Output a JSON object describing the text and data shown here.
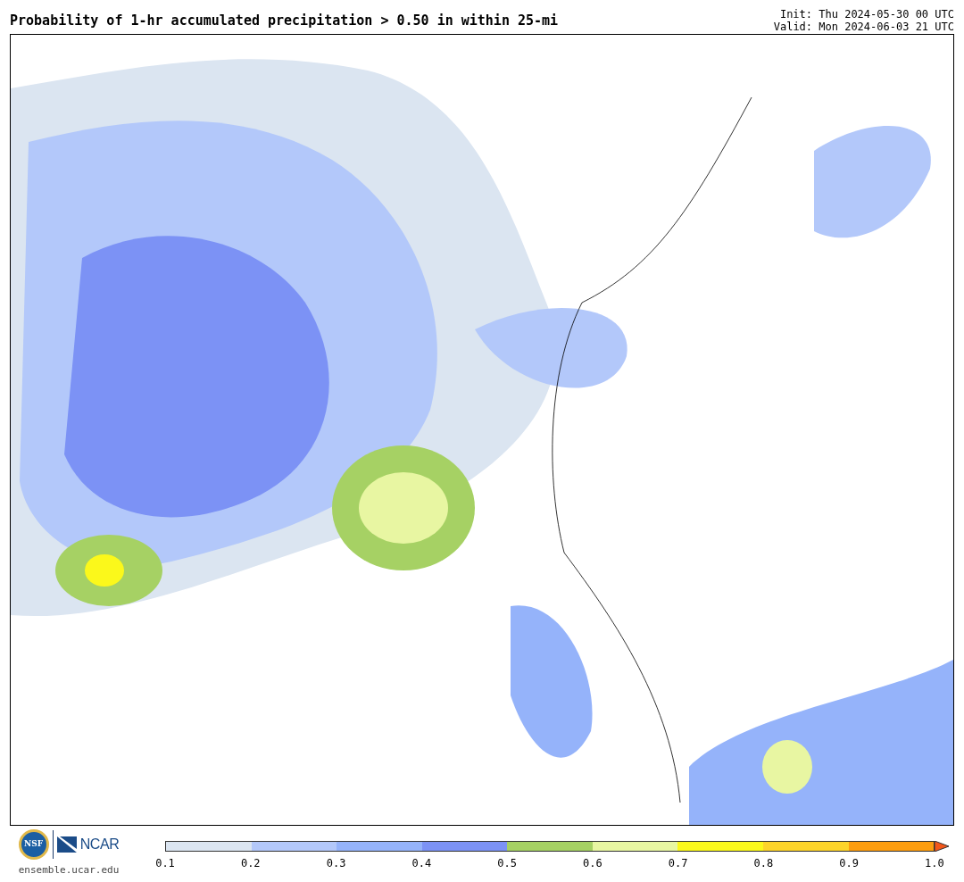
{
  "title": "Probability of 1-hr accumulated precipitation > 0.50 in within 25-mi",
  "init": "Init: Thu 2024-05-30 00 UTC",
  "valid": "Valid: Mon 2024-06-03 21 UTC",
  "logo": {
    "emblem": "NSF",
    "name": "NCAR",
    "site": "ensemble.ucar.edu"
  },
  "colorbar": {
    "bins": [
      {
        "color": "#dbe5f1"
      },
      {
        "color": "#b3c8fa"
      },
      {
        "color": "#95b3fa"
      },
      {
        "color": "#7c92f5"
      },
      {
        "color": "#a6d164"
      },
      {
        "color": "#e8f6a2"
      },
      {
        "color": "#fbf81b"
      },
      {
        "color": "#fdd42a"
      },
      {
        "color": "#fd9d0e"
      }
    ],
    "extension": {
      "color": "#f2561a"
    },
    "ticks": [
      "0.1",
      "0.2",
      "0.3",
      "0.4",
      "0.5",
      "0.6",
      "0.7",
      "0.8",
      "0.9",
      "1.0"
    ]
  }
}
